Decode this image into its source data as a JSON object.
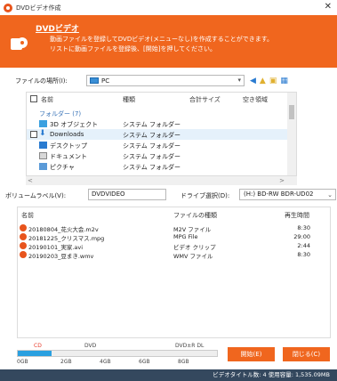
{
  "window": {
    "title": "DVDビデオ作成"
  },
  "banner": {
    "heading": "DVDビデオ",
    "desc_line1": "動画ファイルを登録してDVDビデオ(メニューなし)を作成することができます。",
    "desc_line2": "リストに動画ファイルを登録後、[開始]を押してください。"
  },
  "location": {
    "label": "ファイルの場所(I):",
    "value": "PC"
  },
  "filelist": {
    "columns": [
      "名前",
      "種類",
      "合計サイズ",
      "空き領域"
    ],
    "group": "フォルダー (7)",
    "rows": [
      {
        "name": "3D オブジェクト",
        "type": "システム フォルダー"
      },
      {
        "name": "Downloads",
        "type": "システム フォルダー"
      },
      {
        "name": "デスクトップ",
        "type": "システム フォルダー"
      },
      {
        "name": "ドキュメント",
        "type": "システム フォルダー"
      },
      {
        "name": "ピクチャ",
        "type": "システム フォルダー"
      }
    ]
  },
  "volume": {
    "label": "ボリュームラベル(V):",
    "value": "DVDVIDEO"
  },
  "drive": {
    "label": "ドライブ選択(D):",
    "value": "(H:) BD-RW   BDR-UD02"
  },
  "videolist": {
    "columns": [
      "名前",
      "ファイルの種類",
      "再生時間"
    ],
    "rows": [
      {
        "name": "20180804_花火大会.m2v",
        "type": "M2V ファイル",
        "time": "8:30"
      },
      {
        "name": "20181225_クリスマス.mpg",
        "type": "MPG File",
        "time": "29:00"
      },
      {
        "name": "20190101_実家.avi",
        "type": "ビデオ クリップ",
        "time": "2:44"
      },
      {
        "name": "20190203_豆まき.wmv",
        "type": "WMV ファイル",
        "time": "8:30"
      }
    ]
  },
  "capacity": {
    "marks": [
      "CD",
      "DVD",
      "DVD±R DL"
    ],
    "ticks": [
      "0GB",
      "2GB",
      "4GB",
      "6GB",
      "8GB"
    ],
    "fill_fraction": 0.17
  },
  "buttons": {
    "start": "開始(E)",
    "close": "閉じる(C)"
  },
  "status": "ビデオタイトル数: 4  使用容量: 1,535.09MB",
  "colors": {
    "accent": "#f0661e",
    "status_bg": "#34485e",
    "bar": "#2aa0e0"
  }
}
